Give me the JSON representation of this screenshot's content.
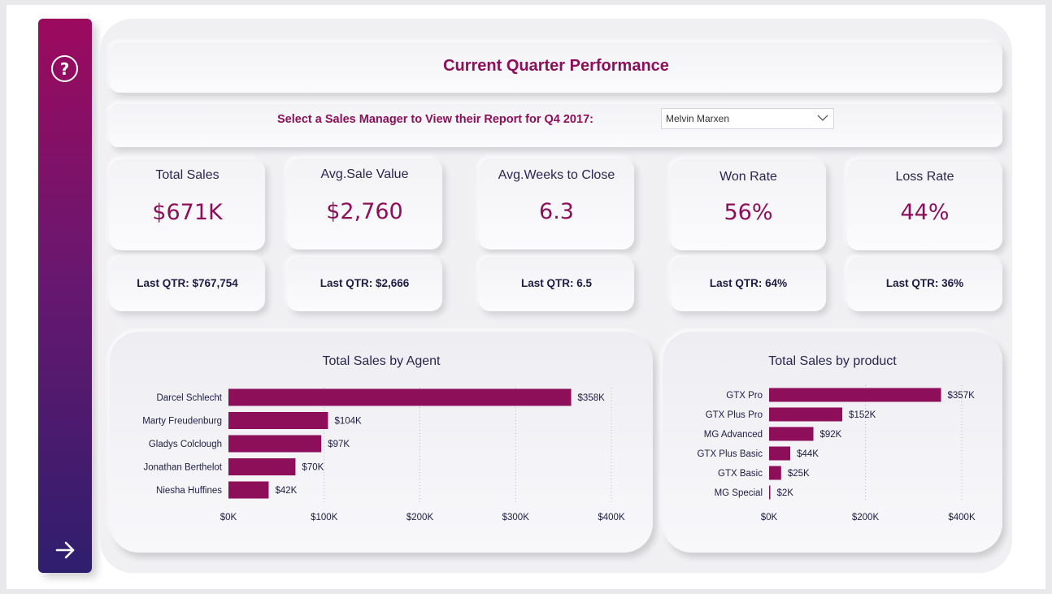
{
  "header": {
    "title": "Current Quarter Performance"
  },
  "filter": {
    "label": "Select a Sales Manager to View their Report for Q4 2017:",
    "selected": "Melvin Marxen"
  },
  "kpis": [
    {
      "label": "Total Sales",
      "value": "$671K",
      "last": "Last QTR: $767,754"
    },
    {
      "label": "Avg.Sale Value",
      "value": "$2,760",
      "last": "Last QTR: $2,666"
    },
    {
      "label": "Avg.Weeks to Close",
      "value": "6.3",
      "last": "Last QTR: 6.5"
    },
    {
      "label": "Won Rate",
      "value": "56%",
      "last": "Last QTR: 64%"
    },
    {
      "label": "Loss Rate",
      "value": "44%",
      "last": "Last QTR: 36%"
    }
  ],
  "colors": {
    "accent": "#8d0f5a",
    "bar": "#8d0f5a",
    "navy": "#2a2550"
  },
  "icons": {
    "help": "question-circle-icon",
    "next": "arrow-right-icon",
    "dropdown": "chevron-down-icon"
  },
  "chart_data": [
    {
      "type": "bar",
      "orientation": "horizontal",
      "title": "Total Sales by Agent",
      "categories": [
        "Darcel Schlecht",
        "Marty Freudenburg",
        "Gladys Colclough",
        "Jonathan Berthelot",
        "Niesha Huffines"
      ],
      "values": [
        358,
        104,
        97,
        70,
        42
      ],
      "data_labels": [
        "$358K",
        "$104K",
        "$97K",
        "$70K",
        "$42K"
      ],
      "xticks": [
        "$0K",
        "$100K",
        "$200K",
        "$300K",
        "$400K"
      ],
      "xlim": [
        0,
        400
      ],
      "grid": true
    },
    {
      "type": "bar",
      "orientation": "horizontal",
      "title": "Total Sales by product",
      "categories": [
        "GTX Pro",
        "GTX Plus Pro",
        "MG Advanced",
        "GTX Plus Basic",
        "GTX Basic",
        "MG Special"
      ],
      "values": [
        357,
        152,
        92,
        44,
        25,
        2
      ],
      "data_labels": [
        "$357K",
        "$152K",
        "$92K",
        "$44K",
        "$25K",
        "$2K"
      ],
      "xticks": [
        "$0K",
        "$200K",
        "$400K"
      ],
      "xlim": [
        0,
        400
      ],
      "grid": true
    }
  ]
}
